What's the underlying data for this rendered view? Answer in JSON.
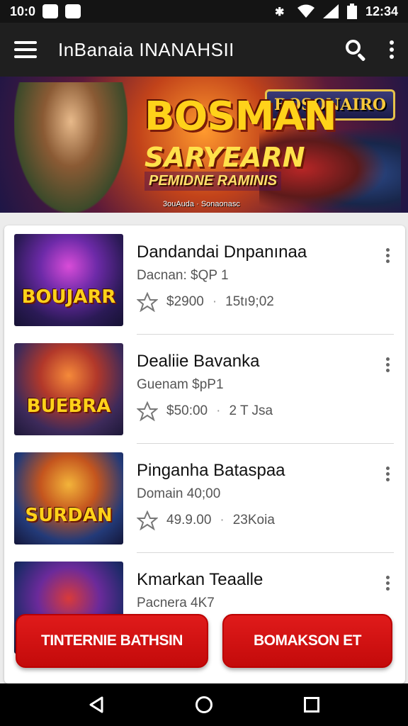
{
  "status_bar": {
    "left_text": "10:0",
    "time": "12:34"
  },
  "app_bar": {
    "title": "InBanaia INANAHSII"
  },
  "banner": {
    "title_line1": "BOSMAN",
    "title_line2": "SARYEARN",
    "title_line3": "PEMIDNE RAMINIS",
    "badge": "BOSONAIRO",
    "caption": "3ouAuda · Sonaonasc"
  },
  "list": {
    "items": [
      {
        "title": "Dandandai Dnpanınaa",
        "subtitle": "Dacnan: $QP 1",
        "price": "$2900",
        "meta": "15tı9;02",
        "thumb_text": "BOUJARR"
      },
      {
        "title": "Dealiie Bavanka",
        "subtitle": "Guenam $pP1",
        "price": "$50:00",
        "meta": "2 T Jsa",
        "thumb_text": "BUEBRA"
      },
      {
        "title": "Pinganha Bataspaa",
        "subtitle": "Domain 40;00",
        "price": "49.9.00",
        "meta": "23Koia",
        "thumb_text": "SURDAN"
      },
      {
        "title": "Kmarkan Teaalle",
        "subtitle": "Pacnera 4K7",
        "price": "",
        "meta": "",
        "thumb_text": ""
      }
    ]
  },
  "buttons": {
    "left_label": "TINTERNIE BATHSIN",
    "right_label": "BOMAKSON ET"
  },
  "colors": {
    "accent_red": "#d61414",
    "app_bar": "#1f1f1f",
    "status_bar": "#141414"
  },
  "icons": {
    "menu": "hamburger-icon",
    "search": "search-icon",
    "overflow": "kebab-icon",
    "rating": "star-outline-icon",
    "nav_back": "back-triangle-icon",
    "nav_home": "home-circle-icon",
    "nav_recents": "recents-square-icon"
  }
}
